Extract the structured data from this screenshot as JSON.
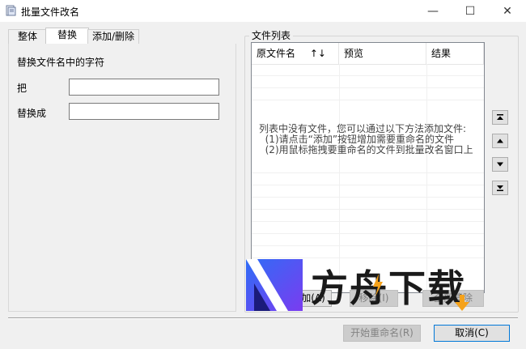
{
  "window": {
    "title": "批量文件改名",
    "minimize_glyph": "—",
    "maximize_glyph": "☐",
    "close_glyph": "✕"
  },
  "tabs": [
    {
      "label": "整体",
      "active": false
    },
    {
      "label": "替换",
      "active": true
    },
    {
      "label": "添加/删除",
      "active": false
    }
  ],
  "replace_panel": {
    "heading": "替换文件名中的字符",
    "find_label": "把",
    "find_value": "",
    "replace_label": "替换成",
    "replace_value": ""
  },
  "file_list": {
    "group_title": "文件列表",
    "columns": [
      {
        "label": "原文件名",
        "sort_glyph": "↑↓"
      },
      {
        "label": "预览"
      },
      {
        "label": "结果"
      }
    ],
    "empty_message": "列表中没有文件，您可以通过以下方法添加文件:\n  (1)请点击“添加”按钮增加需要重命名的文件\n  (2)用鼠标拖拽要重命名的文件到批量改名窗口上"
  },
  "side_buttons": [
    {
      "name": "move-top",
      "icon": "move-top-icon"
    },
    {
      "name": "move-up",
      "icon": "move-up-icon"
    },
    {
      "name": "move-down",
      "icon": "move-down-icon"
    },
    {
      "name": "move-bottom",
      "icon": "move-bottom-icon"
    }
  ],
  "list_buttons": {
    "add_label": "添加(A)",
    "remove_label": "移除(I)",
    "clear_label": "全部清除"
  },
  "footer": {
    "start_label": "开始重命名(R)",
    "cancel_label": "取消(C)"
  },
  "watermark": {
    "text": "方舟下载"
  },
  "colors": {
    "accent_blue": "#2f6df6",
    "accent_orange": "#f5a21b"
  }
}
